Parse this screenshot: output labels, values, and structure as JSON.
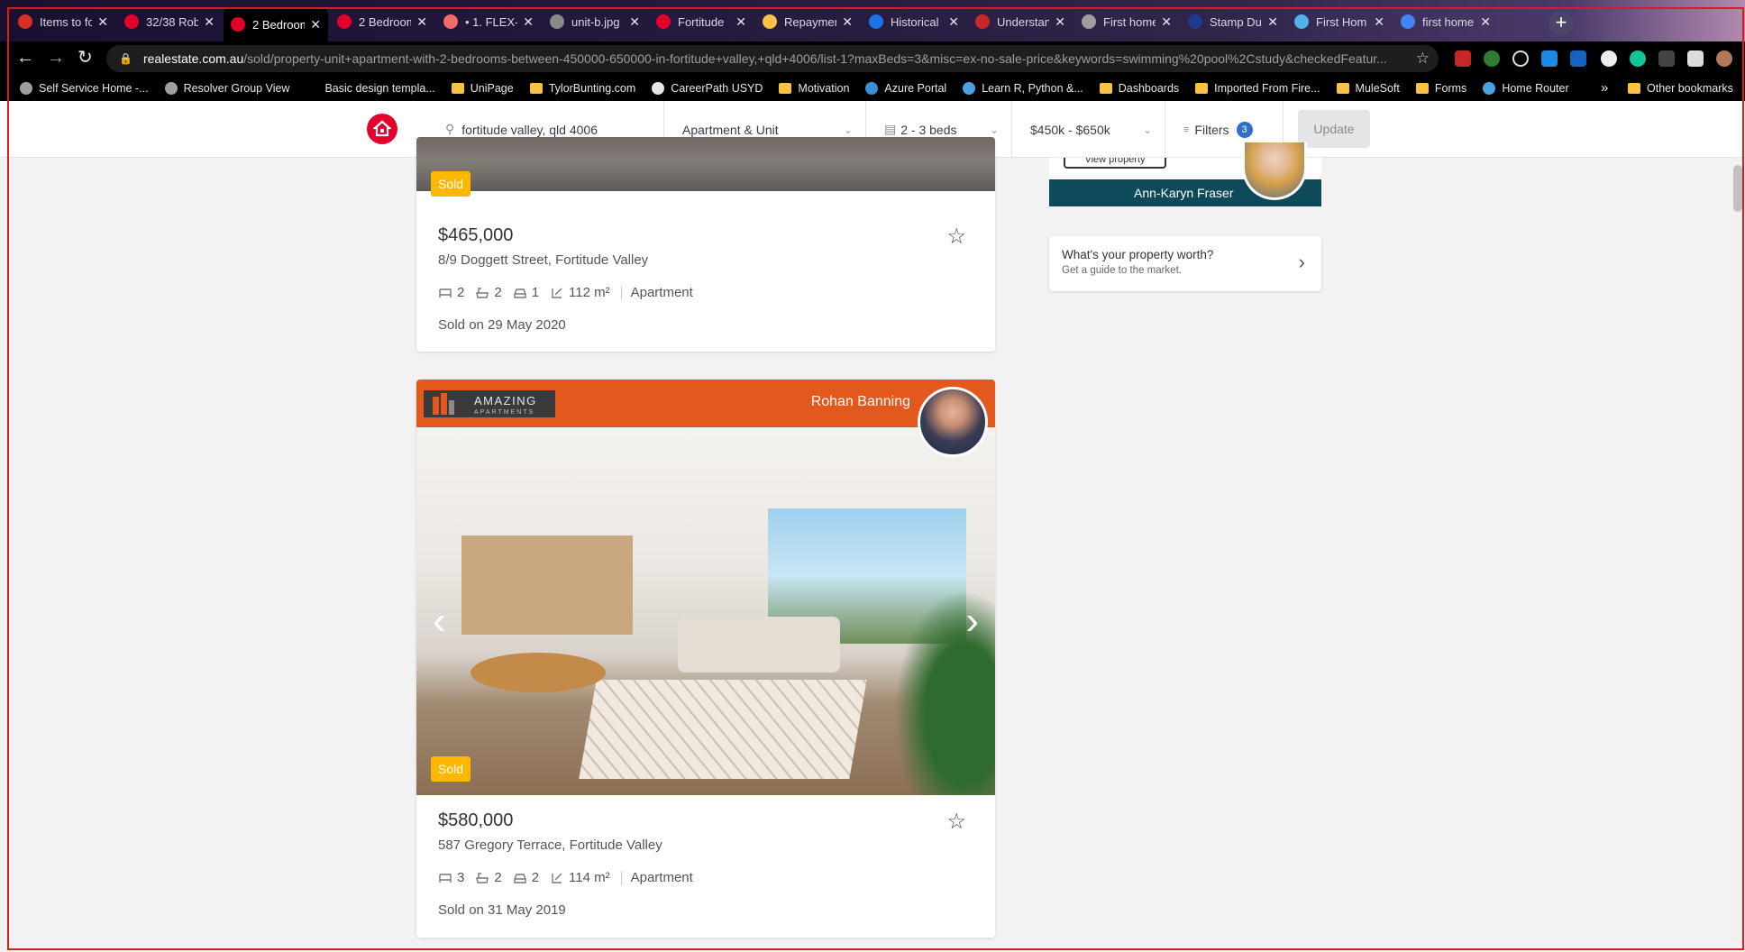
{
  "browser": {
    "tabs": [
      {
        "label": "Items to fo",
        "favicon": "gmail-icon",
        "color": "#d93025",
        "active": false
      },
      {
        "label": "32/38 Rob",
        "favicon": "realestate-icon",
        "color": "#e4002b",
        "active": false
      },
      {
        "label": "2 Bedroom",
        "favicon": "realestate-icon",
        "color": "#e4002b",
        "active": true
      },
      {
        "label": "2 Bedroom",
        "favicon": "realestate-icon",
        "color": "#e4002b",
        "active": false
      },
      {
        "label": "• 1. FLEX-",
        "favicon": "asana-icon",
        "color": "#f06a6a",
        "active": false
      },
      {
        "label": "unit-b.jpg",
        "favicon": "globe-icon",
        "color": "#8a8a8a",
        "active": false
      },
      {
        "label": "Fortitude",
        "favicon": "realestate-icon",
        "color": "#e4002b",
        "active": false
      },
      {
        "label": "Repaymen",
        "favicon": "commbank-icon",
        "color": "#f6c343",
        "active": false
      },
      {
        "label": "Historical",
        "favicon": "chart-icon",
        "color": "#1a73e8",
        "active": false
      },
      {
        "label": "Understan",
        "favicon": "site-icon",
        "color": "#c62828",
        "active": false
      },
      {
        "label": "First home",
        "favicon": "crest-icon",
        "color": "#9e9e9e",
        "active": false
      },
      {
        "label": "Stamp Du",
        "favicon": "flag-icon",
        "color": "#1e3a8a",
        "active": false
      },
      {
        "label": "First Hom",
        "favicon": "site-icon",
        "color": "#4fb3e8",
        "active": false
      },
      {
        "label": "first home",
        "favicon": "google-icon",
        "color": "#4285f4",
        "active": false
      }
    ],
    "url_domain": "realestate.com.au",
    "url_path": "/sold/property-unit+apartment-with-2-bedrooms-between-450000-650000-in-fortitude+valley,+qld+4006/list-1?maxBeds=3&misc=ex-no-sale-price&keywords=swimming%20pool%2Cstudy&checkedFeatur...",
    "bookmarks": [
      {
        "label": "Self Service Home -...",
        "icon": "resolver-icon",
        "color": "#9aa0a6"
      },
      {
        "label": "Resolver Group View",
        "icon": "resolver-icon",
        "color": "#9aa0a6"
      },
      {
        "label": "Basic design templa...",
        "icon": "page-icon",
        "color": "#000000"
      },
      {
        "label": "UniPage",
        "icon": "folder-icon",
        "color": "#f6c343"
      },
      {
        "label": "TylorBunting.com",
        "icon": "folder-icon",
        "color": "#f6c343"
      },
      {
        "label": "CareerPath USYD",
        "icon": "globe-icon",
        "color": "#e8e8e8"
      },
      {
        "label": "Motivation",
        "icon": "folder-icon",
        "color": "#f6c343"
      },
      {
        "label": "Azure Portal",
        "icon": "azure-icon",
        "color": "#3b8fd9"
      },
      {
        "label": "Learn R, Python &...",
        "icon": "shield-icon",
        "color": "#4aa3df"
      },
      {
        "label": "Dashboards",
        "icon": "folder-icon",
        "color": "#f6c343"
      },
      {
        "label": "Imported From Fire...",
        "icon": "folder-icon",
        "color": "#f6c343"
      },
      {
        "label": "MuleSoft",
        "icon": "folder-icon",
        "color": "#f6c343"
      },
      {
        "label": "Forms",
        "icon": "folder-icon",
        "color": "#f6c343"
      },
      {
        "label": "Home Router",
        "icon": "router-icon",
        "color": "#4aa3df"
      }
    ],
    "bookmarks_more": "»",
    "other_bookmarks": "Other bookmarks"
  },
  "search": {
    "location": "fortitude valley, qld 4006",
    "property_type": "Apartment & Unit",
    "beds": "2 - 3 beds",
    "price": "$450k - $650k",
    "filters_label": "Filters",
    "filters_count": "3",
    "update_label": "Update"
  },
  "listings": [
    {
      "price": "$465,000",
      "address": "8/9 Doggett Street, Fortitude Valley",
      "beds": "2",
      "baths": "2",
      "cars": "1",
      "area": "112 m²",
      "type": "Apartment",
      "sold_on": "Sold on 29 May 2020",
      "badge": "Sold"
    },
    {
      "price": "$580,000",
      "address": "587 Gregory Terrace, Fortitude Valley",
      "beds": "3",
      "baths": "2",
      "cars": "2",
      "area": "114 m²",
      "type": "Apartment",
      "sold_on": "Sold on 31 May 2019",
      "badge": "Sold",
      "agency": "AMAZING",
      "agency_sub": "APARTMENTS",
      "agent": "Rohan Banning",
      "brand_color": "#e3581d"
    }
  ],
  "sidebar": {
    "view_property": "View property",
    "agent": "Ann-Karyn Fraser",
    "worth_title": "What's your property worth?",
    "worth_sub": "Get a guide to the market."
  },
  "colors": {
    "brand": "#e4002b",
    "sold": "#ffb700",
    "agent_bar": "#0e4a59"
  }
}
